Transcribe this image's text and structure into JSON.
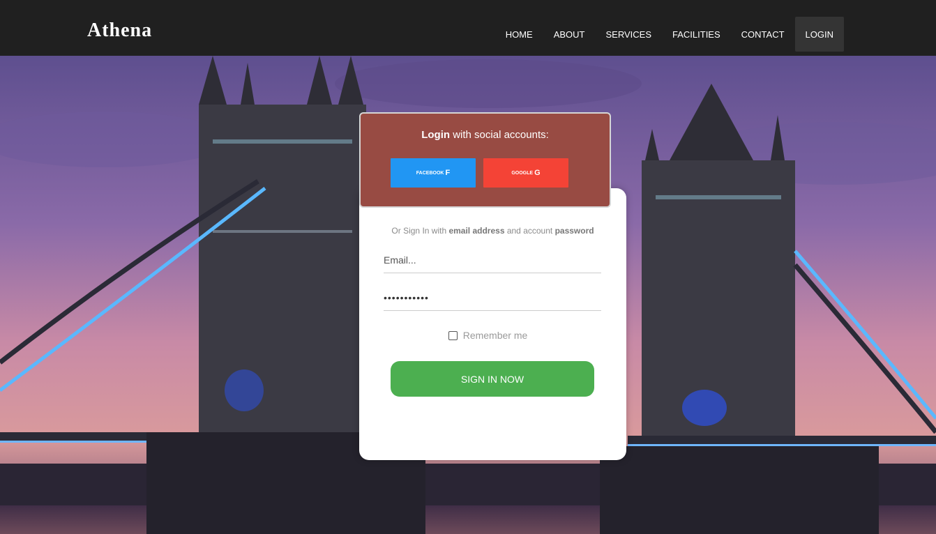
{
  "nav": {
    "brand": "Athena",
    "items": [
      {
        "label": "HOME"
      },
      {
        "label": "ABOUT"
      },
      {
        "label": "SERVICES"
      },
      {
        "label": "FACILITIES"
      },
      {
        "label": "CONTACT"
      },
      {
        "label": "LOGIN",
        "active": true
      }
    ]
  },
  "login": {
    "social_title_bold": "Login",
    "social_title_rest": " with social accounts:",
    "facebook_label": "FACEBOOK",
    "facebook_icon": "f",
    "google_label": "GOOGLE",
    "google_icon": "G",
    "or_prefix": "Or Sign In with ",
    "or_email": "email address",
    "or_mid": " and account ",
    "or_password": "password",
    "email_placeholder": "Email...",
    "password_value": "•••••••••••",
    "remember_label": "Remember me",
    "signin_label": "SIGN IN NOW"
  },
  "colors": {
    "navbar": "#202020",
    "social_header": "#984b43",
    "facebook": "#2196f3",
    "google": "#f44336",
    "signin": "#4caf50"
  }
}
